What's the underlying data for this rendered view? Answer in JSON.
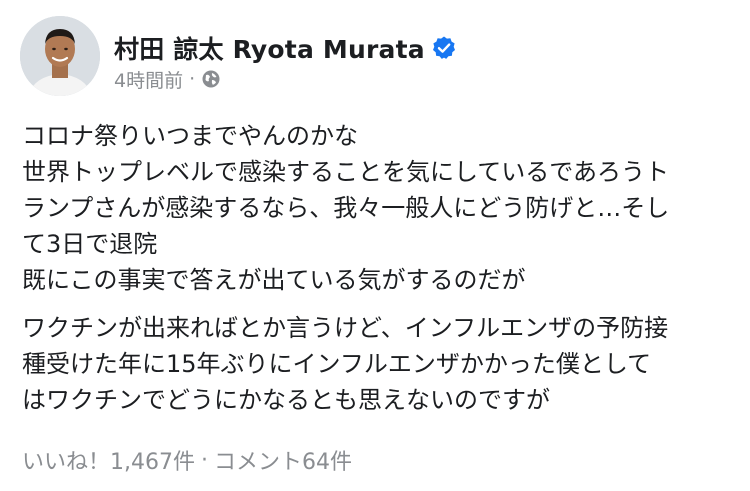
{
  "post": {
    "author": "村田 諒太 Ryota Murata",
    "time": "4時間前",
    "separator": "·",
    "privacy_icon": "globe-icon",
    "verified_icon": "verified-badge-icon",
    "paragraphs": [
      [
        "コロナ祭りいつまでやんのかな",
        "世界トップレベルで感染することを気にしているであろうト",
        "ランプさんが感染するなら、我々一般人にどう防げと…そし",
        "て3日で退院",
        "既にこの事実で答えが出ている気がするのだが"
      ],
      [
        "ワクチンが出来ればとか言うけど、インフルエンザの予防接",
        "種受けた年に15年ぶりにインフルエンザかかった僕として",
        "はワクチンでどうにかなるとも思えないのですが"
      ]
    ],
    "likes": "いいね！1,467件",
    "comments": "コメント64件"
  },
  "colors": {
    "text": "#1c1e21",
    "muted": "#8a8d91",
    "verified_blue": "#1877f2"
  }
}
